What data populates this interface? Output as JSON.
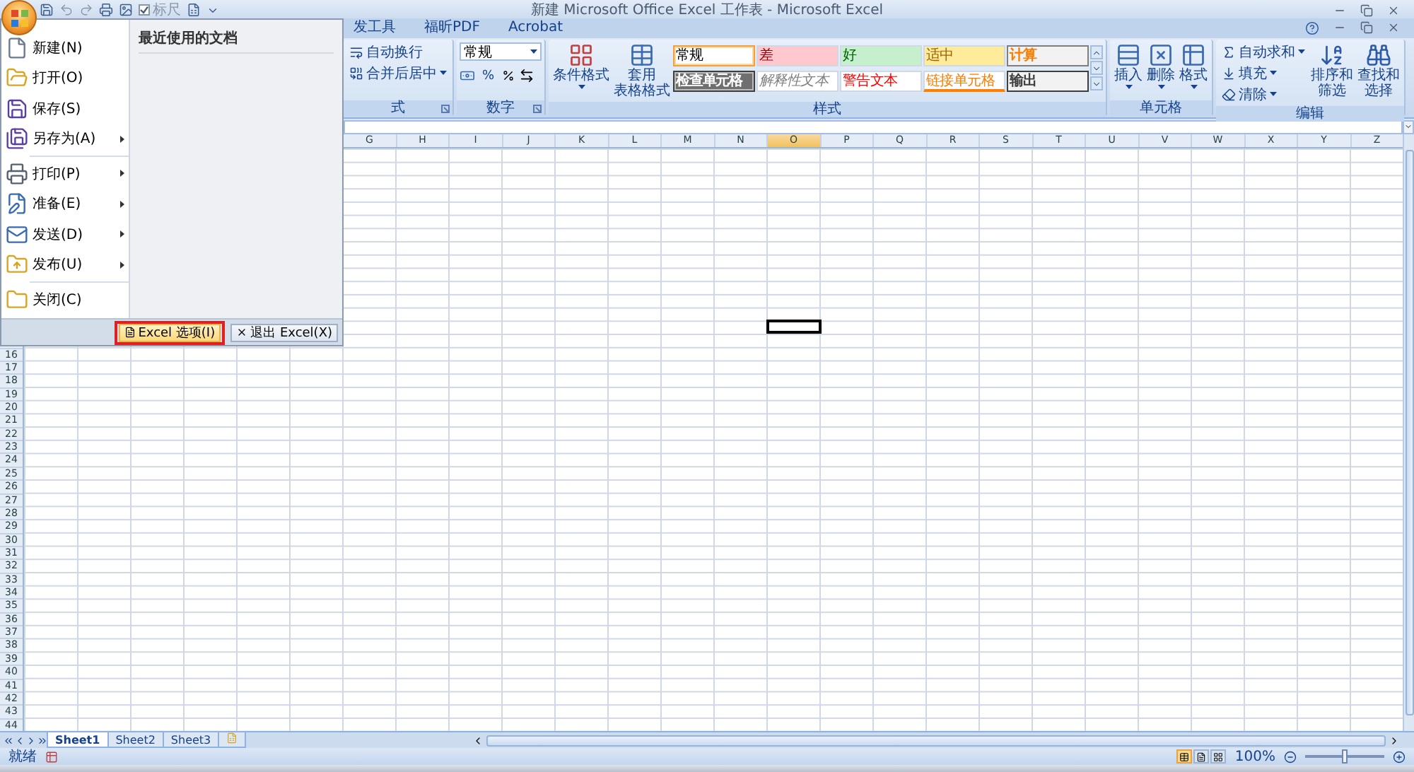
{
  "window": {
    "title": "新建 Microsoft Office Excel 工作表 - Microsoft Excel"
  },
  "quick_access": {
    "ruler": {
      "label": "标尺",
      "checked": true
    }
  },
  "ribbon_tabs": [
    {
      "label": "发工具",
      "selected": false
    },
    {
      "label": "福昕PDF",
      "selected": false
    },
    {
      "label": "Acrobat",
      "selected": false
    }
  ],
  "ribbon": {
    "alignment": {
      "label": "式",
      "wrap": "自动换行",
      "merge": "合并后居中"
    },
    "number": {
      "label": "数字",
      "format": "常规",
      "percent": "%"
    },
    "styles": {
      "label": "样式",
      "conditional": "条件格式",
      "table": [
        "套用",
        "表格格式"
      ],
      "gallery": [
        {
          "label": "常规",
          "kind": "normal",
          "selected": true
        },
        {
          "label": "差",
          "kind": "bad",
          "selected": false
        },
        {
          "label": "好",
          "kind": "good",
          "selected": false
        },
        {
          "label": "适中",
          "kind": "neutral",
          "selected": false
        },
        {
          "label": "计算",
          "kind": "calculation",
          "selected": false
        },
        {
          "label": "检查单元格",
          "kind": "check",
          "selected": false
        },
        {
          "label": "解释性文本",
          "kind": "explanatory",
          "selected": false
        },
        {
          "label": "警告文本",
          "kind": "warning",
          "selected": false
        },
        {
          "label": "链接单元格",
          "kind": "linked",
          "selected": false
        },
        {
          "label": "输出",
          "kind": "output",
          "selected": false
        }
      ]
    },
    "cells": {
      "label": "单元格",
      "buttons": [
        {
          "label": "插入",
          "kind": "insert"
        },
        {
          "label": "删除",
          "kind": "delete"
        },
        {
          "label": "格式",
          "kind": "format"
        }
      ]
    },
    "editing": {
      "label": "编辑",
      "small": [
        {
          "label": "自动求和",
          "kind": "sum"
        },
        {
          "label": "填充",
          "kind": "fill"
        },
        {
          "label": "清除",
          "kind": "clear"
        }
      ],
      "big": [
        {
          "lines": [
            "排序和",
            "筛选"
          ],
          "kind": "sort"
        },
        {
          "lines": [
            "查找和",
            "选择"
          ],
          "kind": "find"
        }
      ]
    }
  },
  "columns": [
    {
      "label": "G",
      "selected": false
    },
    {
      "label": "H",
      "selected": false
    },
    {
      "label": "I",
      "selected": false
    },
    {
      "label": "J",
      "selected": false
    },
    {
      "label": "K",
      "selected": false
    },
    {
      "label": "L",
      "selected": false
    },
    {
      "label": "M",
      "selected": false
    },
    {
      "label": "N",
      "selected": false
    },
    {
      "label": "O",
      "selected": true
    },
    {
      "label": "P",
      "selected": false
    },
    {
      "label": "Q",
      "selected": false
    },
    {
      "label": "R",
      "selected": false
    },
    {
      "label": "S",
      "selected": false
    },
    {
      "label": "T",
      "selected": false
    },
    {
      "label": "U",
      "selected": false
    },
    {
      "label": "V",
      "selected": false
    },
    {
      "label": "W",
      "selected": false
    },
    {
      "label": "X",
      "selected": false
    },
    {
      "label": "Y",
      "selected": false
    },
    {
      "label": "Z",
      "selected": false
    }
  ],
  "rows": [
    "16",
    "17",
    "18",
    "19",
    "20",
    "21",
    "22",
    "23",
    "24",
    "25",
    "26",
    "27",
    "28",
    "29",
    "30",
    "31",
    "32",
    "33",
    "34",
    "35",
    "36",
    "37",
    "38",
    "39",
    "40",
    "41",
    "42",
    "43",
    "44"
  ],
  "sheet_tabs": [
    {
      "label": "Sheet1",
      "selected": true
    },
    {
      "label": "Sheet2",
      "selected": false
    },
    {
      "label": "Sheet3",
      "selected": false
    }
  ],
  "status_bar": {
    "text": "就绪",
    "views": [
      {
        "kind": "normal",
        "selected": true
      },
      {
        "kind": "layout",
        "selected": false
      },
      {
        "kind": "break",
        "selected": false
      }
    ],
    "zoom": "100%",
    "zoom_slider": {
      "level": 0.5
    }
  },
  "office_menu": {
    "groups": [
      [
        {
          "label": "新建(N)",
          "kind": "new",
          "submenu": false
        },
        {
          "label": "打开(O)",
          "kind": "open",
          "submenu": false
        },
        {
          "label": "保存(S)",
          "kind": "save",
          "submenu": false
        },
        {
          "label": "另存为(A)",
          "kind": "save_as",
          "submenu": true
        }
      ],
      [
        {
          "label": "打印(P)",
          "kind": "print",
          "submenu": true
        },
        {
          "label": "准备(E)",
          "kind": "prepare",
          "submenu": true
        },
        {
          "label": "发送(D)",
          "kind": "send",
          "submenu": true
        },
        {
          "label": "发布(U)",
          "kind": "publish",
          "submenu": true
        }
      ],
      [
        {
          "label": "关闭(C)",
          "kind": "close",
          "submenu": false
        }
      ]
    ],
    "recent_title": "最近使用的文档",
    "buttons": [
      {
        "label": "Excel 选项(I)",
        "kind": "options",
        "highlighted": true
      },
      {
        "label": "退出 Excel(X)",
        "kind": "exit",
        "highlighted": false
      }
    ]
  }
}
